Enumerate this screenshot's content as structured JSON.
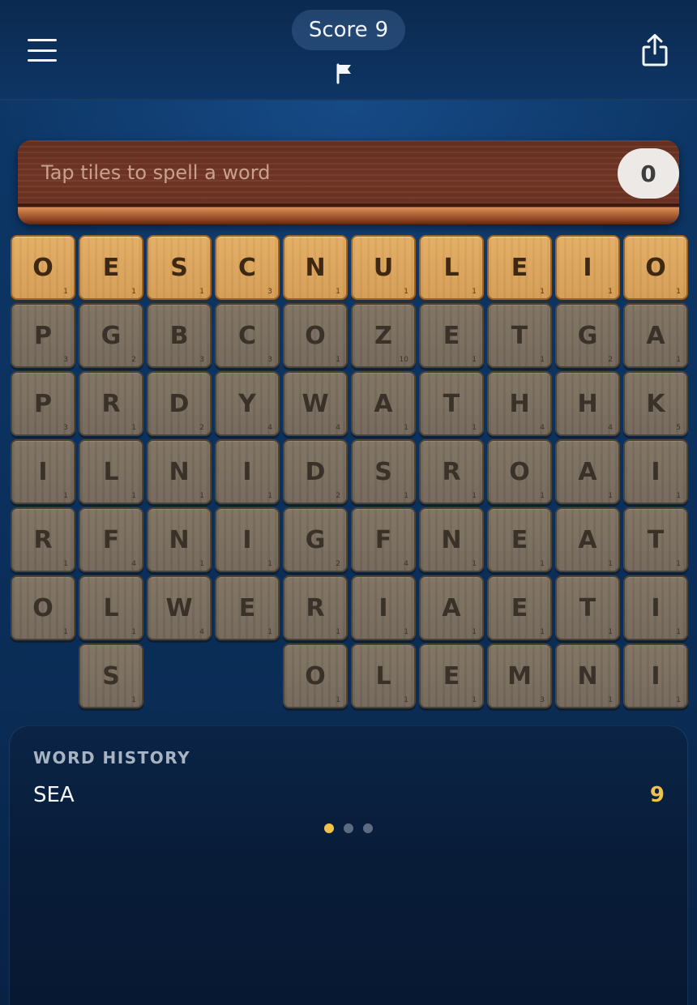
{
  "header": {
    "score_label": "Score",
    "score_value": "9",
    "menu_icon": "hamburger-menu-icon",
    "flag_icon": "flag-icon",
    "share_icon": "share-icon"
  },
  "word_bar": {
    "placeholder": "Tap tiles to spell a word",
    "current_score": "0"
  },
  "board": {
    "rows": [
      [
        {
          "l": "O",
          "p": "1",
          "s": "gold"
        },
        {
          "l": "E",
          "p": "1",
          "s": "gold"
        },
        {
          "l": "S",
          "p": "1",
          "s": "gold"
        },
        {
          "l": "C",
          "p": "3",
          "s": "gold"
        },
        {
          "l": "N",
          "p": "1",
          "s": "gold"
        },
        {
          "l": "U",
          "p": "1",
          "s": "gold"
        },
        {
          "l": "L",
          "p": "1",
          "s": "gold"
        },
        {
          "l": "E",
          "p": "1",
          "s": "gold"
        },
        {
          "l": "I",
          "p": "1",
          "s": "gold"
        },
        {
          "l": "O",
          "p": "1",
          "s": "gold"
        }
      ],
      [
        {
          "l": "P",
          "p": "3",
          "s": "gray"
        },
        {
          "l": "G",
          "p": "2",
          "s": "gray"
        },
        {
          "l": "B",
          "p": "3",
          "s": "gray"
        },
        {
          "l": "C",
          "p": "3",
          "s": "gray"
        },
        {
          "l": "O",
          "p": "1",
          "s": "gray"
        },
        {
          "l": "Z",
          "p": "10",
          "s": "gray"
        },
        {
          "l": "E",
          "p": "1",
          "s": "gray"
        },
        {
          "l": "T",
          "p": "1",
          "s": "gray"
        },
        {
          "l": "G",
          "p": "2",
          "s": "gray"
        },
        {
          "l": "A",
          "p": "1",
          "s": "gray"
        }
      ],
      [
        {
          "l": "P",
          "p": "3",
          "s": "gray"
        },
        {
          "l": "R",
          "p": "1",
          "s": "gray"
        },
        {
          "l": "D",
          "p": "2",
          "s": "gray"
        },
        {
          "l": "Y",
          "p": "4",
          "s": "gray"
        },
        {
          "l": "W",
          "p": "4",
          "s": "gray"
        },
        {
          "l": "A",
          "p": "1",
          "s": "gray"
        },
        {
          "l": "T",
          "p": "1",
          "s": "gray"
        },
        {
          "l": "H",
          "p": "4",
          "s": "gray"
        },
        {
          "l": "H",
          "p": "4",
          "s": "gray"
        },
        {
          "l": "K",
          "p": "5",
          "s": "gray"
        }
      ],
      [
        {
          "l": "I",
          "p": "1",
          "s": "gray"
        },
        {
          "l": "L",
          "p": "1",
          "s": "gray"
        },
        {
          "l": "N",
          "p": "1",
          "s": "gray"
        },
        {
          "l": "I",
          "p": "1",
          "s": "gray"
        },
        {
          "l": "D",
          "p": "2",
          "s": "gray"
        },
        {
          "l": "S",
          "p": "1",
          "s": "gray"
        },
        {
          "l": "R",
          "p": "1",
          "s": "gray"
        },
        {
          "l": "O",
          "p": "1",
          "s": "gray"
        },
        {
          "l": "A",
          "p": "1",
          "s": "gray"
        },
        {
          "l": "I",
          "p": "1",
          "s": "gray"
        }
      ],
      [
        {
          "l": "R",
          "p": "1",
          "s": "gray"
        },
        {
          "l": "F",
          "p": "4",
          "s": "gray"
        },
        {
          "l": "N",
          "p": "1",
          "s": "gray"
        },
        {
          "l": "I",
          "p": "1",
          "s": "gray"
        },
        {
          "l": "G",
          "p": "2",
          "s": "gray"
        },
        {
          "l": "F",
          "p": "4",
          "s": "gray"
        },
        {
          "l": "N",
          "p": "1",
          "s": "gray"
        },
        {
          "l": "E",
          "p": "1",
          "s": "gray"
        },
        {
          "l": "A",
          "p": "1",
          "s": "gray"
        },
        {
          "l": "T",
          "p": "1",
          "s": "gray"
        }
      ],
      [
        {
          "l": "O",
          "p": "1",
          "s": "gray"
        },
        {
          "l": "L",
          "p": "1",
          "s": "gray"
        },
        {
          "l": "W",
          "p": "4",
          "s": "gray"
        },
        {
          "l": "E",
          "p": "1",
          "s": "gray"
        },
        {
          "l": "R",
          "p": "1",
          "s": "gray"
        },
        {
          "l": "I",
          "p": "1",
          "s": "gray"
        },
        {
          "l": "A",
          "p": "1",
          "s": "gray"
        },
        {
          "l": "E",
          "p": "1",
          "s": "gray"
        },
        {
          "l": "T",
          "p": "1",
          "s": "gray"
        },
        {
          "l": "I",
          "p": "1",
          "s": "gray"
        }
      ],
      [
        null,
        {
          "l": "S",
          "p": "1",
          "s": "gray"
        },
        null,
        null,
        {
          "l": "O",
          "p": "1",
          "s": "gray"
        },
        {
          "l": "L",
          "p": "1",
          "s": "gray"
        },
        {
          "l": "E",
          "p": "1",
          "s": "gray"
        },
        {
          "l": "M",
          "p": "3",
          "s": "gray"
        },
        {
          "l": "N",
          "p": "1",
          "s": "gray"
        },
        {
          "l": "I",
          "p": "1",
          "s": "gray"
        }
      ]
    ]
  },
  "history": {
    "title": "WORD HISTORY",
    "entries": [
      {
        "word": "SEA",
        "points": "9"
      }
    ],
    "pages": 3,
    "active_page": 0
  },
  "colors": {
    "background": "#0c3463",
    "accent_gold": "#f1c24a",
    "selected_tile": "#d9a35a",
    "unselected_tile": "#7a6d5e",
    "word_bar": "#6f3424"
  }
}
